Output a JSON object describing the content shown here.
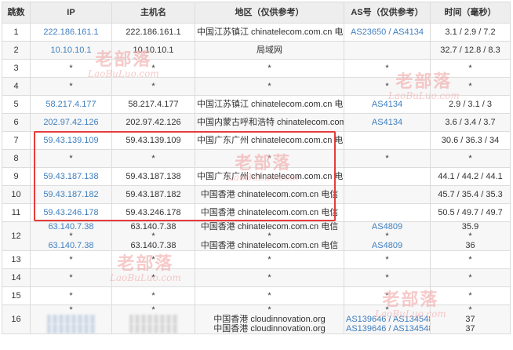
{
  "headers": [
    "跳数",
    "IP",
    "主机名",
    "地区（仅供参考）",
    "AS号（仅供参考）",
    "时间（毫秒）"
  ],
  "rows": [
    {
      "hop": "1",
      "ip": [
        "222.186.161.1"
      ],
      "host": [
        "222.186.161.1"
      ],
      "region": [
        "中国江苏镇江 chinatelecom.com.cn 电信"
      ],
      "as": [
        "AS23650 / AS4134"
      ],
      "time": [
        "3.1 / 2.9 / 7.2"
      ]
    },
    {
      "hop": "2",
      "ip": [
        "10.10.10.1"
      ],
      "host": [
        "10.10.10.1"
      ],
      "region": [
        "局域网"
      ],
      "as": [
        ""
      ],
      "time": [
        "32.7 / 12.8 / 8.3"
      ]
    },
    {
      "hop": "3",
      "ip": [
        "*"
      ],
      "host": [
        "*"
      ],
      "region": [
        "*"
      ],
      "as": [
        "*"
      ],
      "time": [
        "*"
      ]
    },
    {
      "hop": "4",
      "ip": [
        "*"
      ],
      "host": [
        "*"
      ],
      "region": [
        "*"
      ],
      "as": [
        "*"
      ],
      "time": [
        "*"
      ]
    },
    {
      "hop": "5",
      "ip": [
        "58.217.4.177"
      ],
      "host": [
        "58.217.4.177"
      ],
      "region": [
        "中国江苏镇江 chinatelecom.com.cn 电信"
      ],
      "as": [
        "AS4134"
      ],
      "time": [
        "2.9 / 3.1 / 3"
      ]
    },
    {
      "hop": "6",
      "ip": [
        "202.97.42.126"
      ],
      "host": [
        "202.97.42.126"
      ],
      "region": [
        "中国内蒙古呼和浩特 chinatelecom.com.cn 电信"
      ],
      "as": [
        "AS4134"
      ],
      "time": [
        "3.6 / 3.4 / 3.7"
      ]
    },
    {
      "hop": "7",
      "ip": [
        "59.43.139.109"
      ],
      "host": [
        "59.43.139.109"
      ],
      "region": [
        "中国广东广州 chinatelecom.com.cn 电信"
      ],
      "as": [
        ""
      ],
      "time": [
        "30.6 / 36.3 / 34"
      ]
    },
    {
      "hop": "8",
      "ip": [
        "*"
      ],
      "host": [
        "*"
      ],
      "region": [
        "*"
      ],
      "as": [
        "*"
      ],
      "time": [
        "*"
      ]
    },
    {
      "hop": "9",
      "ip": [
        "59.43.187.138"
      ],
      "host": [
        "59.43.187.138"
      ],
      "region": [
        "中国广东广州 chinatelecom.com.cn 电信"
      ],
      "as": [
        ""
      ],
      "time": [
        "44.1 / 44.2 / 44.1"
      ]
    },
    {
      "hop": "10",
      "ip": [
        "59.43.187.182"
      ],
      "host": [
        "59.43.187.182"
      ],
      "region": [
        "中国香港 chinatelecom.com.cn 电信"
      ],
      "as": [
        ""
      ],
      "time": [
        "45.7 / 35.4 / 35.3"
      ]
    },
    {
      "hop": "11",
      "ip": [
        "59.43.246.178"
      ],
      "host": [
        "59.43.246.178"
      ],
      "region": [
        "中国香港 chinatelecom.com.cn 电信"
      ],
      "as": [
        ""
      ],
      "time": [
        "50.5 / 49.7 / 49.7"
      ]
    },
    {
      "hop": "12",
      "ip": [
        "63.140.7.38",
        "*",
        "63.140.7.38"
      ],
      "host": [
        "63.140.7.38",
        "*",
        "63.140.7.38"
      ],
      "region": [
        "中国香港 chinatelecom.com.cn 电信",
        "*",
        "中国香港 chinatelecom.com.cn 电信"
      ],
      "as": [
        "AS4809",
        "*",
        "AS4809"
      ],
      "time": [
        "35.9",
        "*",
        "36"
      ]
    },
    {
      "hop": "13",
      "ip": [
        "*"
      ],
      "host": [
        "*"
      ],
      "region": [
        "*"
      ],
      "as": [
        "*"
      ],
      "time": [
        "*"
      ]
    },
    {
      "hop": "14",
      "ip": [
        "*"
      ],
      "host": [
        "*"
      ],
      "region": [
        "*"
      ],
      "as": [
        "*"
      ],
      "time": [
        "*"
      ]
    },
    {
      "hop": "15",
      "ip": [
        "*"
      ],
      "host": [
        "*"
      ],
      "region": [
        "*"
      ],
      "as": [
        "*"
      ],
      "time": [
        "*"
      ]
    },
    {
      "hop": "16",
      "ip": [
        "*",
        "",
        ""
      ],
      "host": [
        "*",
        "",
        ""
      ],
      "region": [
        "*",
        "中国香港 cloudinnovation.org",
        "中国香港 cloudinnovation.org"
      ],
      "as": [
        "*",
        "AS139646 / AS134548",
        "AS139646 / AS134548"
      ],
      "time": [
        "*",
        "37",
        "37"
      ],
      "redacted": true
    }
  ],
  "watermark": {
    "cn": "老部落",
    "en": "LaoBuLuo.com"
  },
  "colors": {
    "link": "#3f7fbf",
    "header_bg": "#eeeeee",
    "highlight": "#e63c3c",
    "watermark": "#f2a7a7"
  }
}
